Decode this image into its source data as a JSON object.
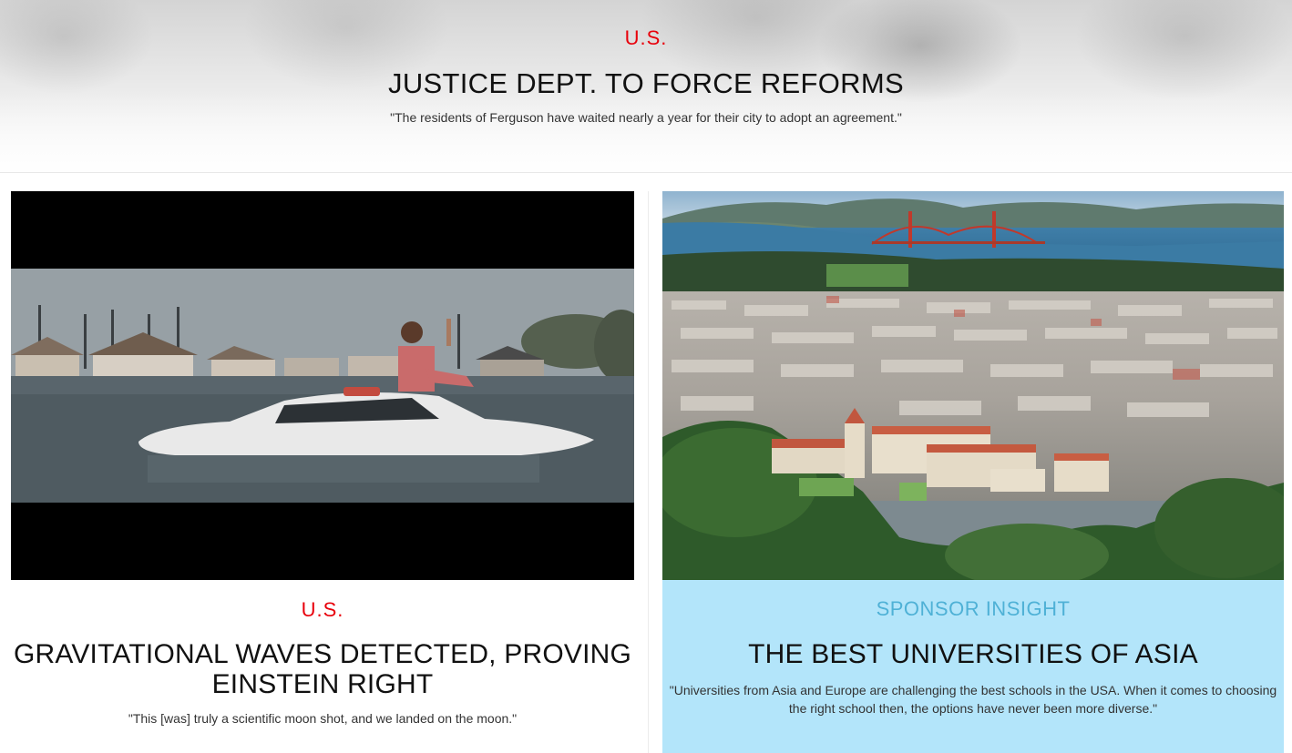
{
  "hero": {
    "category": "U.S.",
    "title": "JUSTICE DEPT. TO FORCE REFORMS",
    "quote": "\"The residents of Ferguson have waited nearly a year for their city to adopt an agreement.\""
  },
  "cards": [
    {
      "category": "U.S.",
      "title": "GRAVITATIONAL WAVES DETECTED, PROVING EINSTEIN RIGHT",
      "quote": "\"This [was] truly a scientific moon shot, and we landed on the moon.\"",
      "image": "flooded-street-car-photo"
    },
    {
      "category": "SPONSOR INSIGHT",
      "title": "THE BEST UNIVERSITIES OF ASIA",
      "quote": "\"Universities from Asia and Europe are challenging the best schools in the USA. When it comes to choosing the right school then, the options have never been more diverse.\"",
      "image": "aerial-city-campus-photo"
    }
  ],
  "colors": {
    "category_red": "#e8000b",
    "sponsor_blue": "#4fb1d6",
    "sponsor_bg": "#b3e5fa"
  }
}
